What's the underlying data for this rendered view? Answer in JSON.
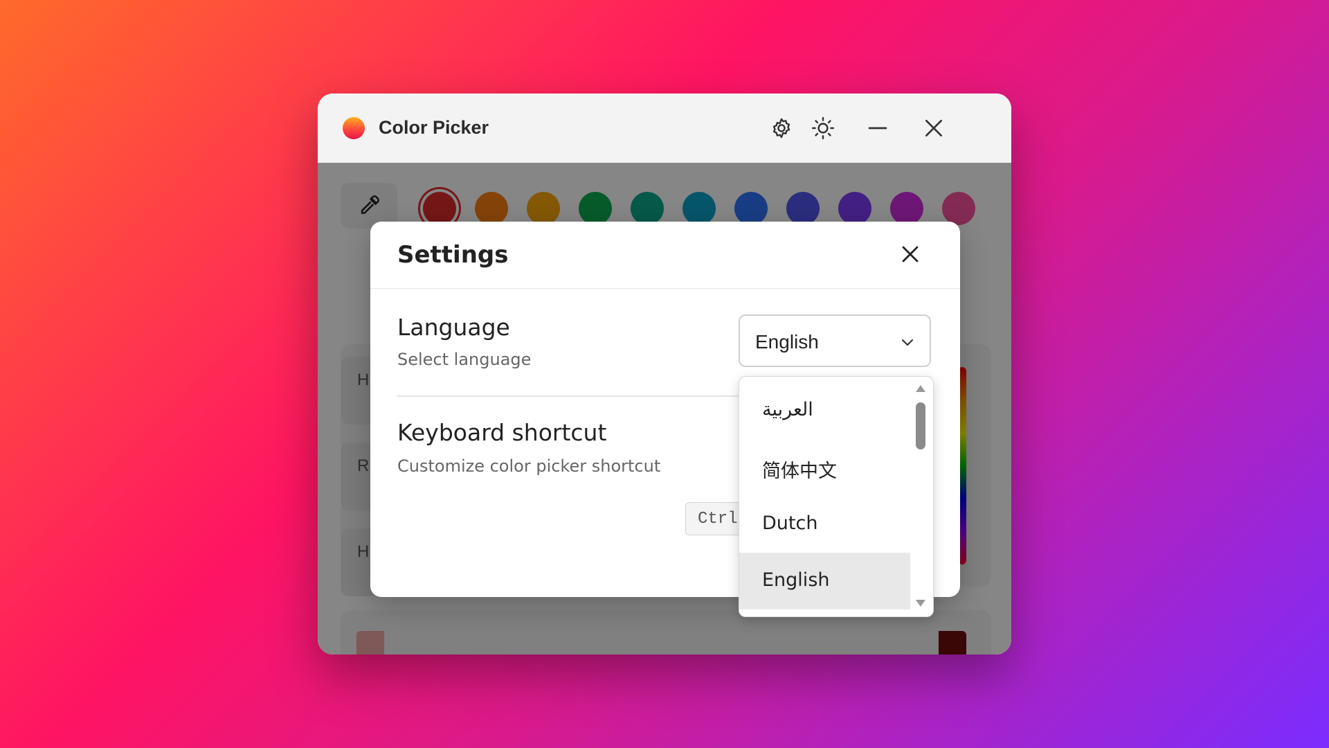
{
  "window": {
    "title": "Color Picker",
    "icons": {
      "settings": "gear-icon",
      "theme": "sun-icon",
      "minimize": "minimize-icon",
      "close": "close-icon"
    }
  },
  "picker": {
    "eyedropper_icon": "eyedropper-icon",
    "swatches": [
      {
        "color": "#d62b2b",
        "selected": true
      },
      {
        "color": "#f27a12"
      },
      {
        "color": "#f0a00a"
      },
      {
        "color": "#0ea64f"
      },
      {
        "color": "#0ea388"
      },
      {
        "color": "#0b9dc2"
      },
      {
        "color": "#2f6ff0"
      },
      {
        "color": "#4f52e6"
      },
      {
        "color": "#7a3bef"
      },
      {
        "color": "#c92ad8"
      },
      {
        "color": "#f04f9a"
      }
    ],
    "row_labels": [
      "H",
      "R",
      "H"
    ]
  },
  "settings": {
    "title": "Settings",
    "language": {
      "label": "Language",
      "description": "Select language",
      "selected": "English",
      "options": [
        "العربية",
        "简体中文",
        "Dutch",
        "English"
      ],
      "highlighted_index": 3
    },
    "shortcut": {
      "label": "Keyboard shortcut",
      "description": "Customize color picker shortcut",
      "value": "Ctrl"
    }
  }
}
